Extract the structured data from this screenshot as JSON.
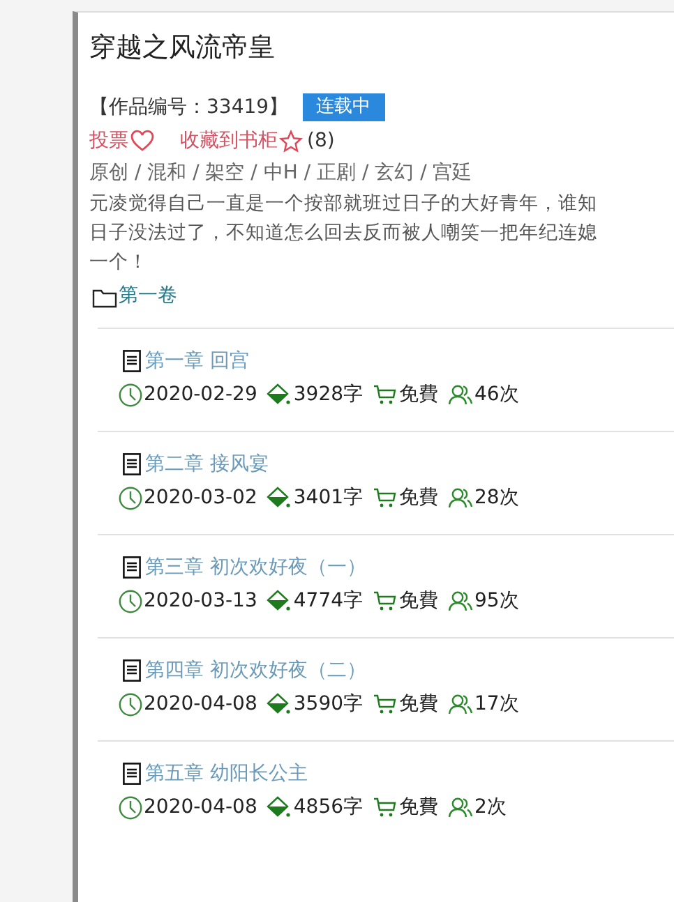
{
  "title": "穿越之风流帝皇",
  "work_id": "【作品编号：33419】",
  "status_badge": "连载中",
  "actions": [
    {
      "kind": "vote",
      "label": "投票"
    },
    {
      "kind": "favorite",
      "label": "收藏到书柜"
    }
  ],
  "favorite_count": "(8)",
  "tags": "原创 / 混和 / 架空 / 中H / 正剧 / 玄幻 / 宫廷",
  "summary_lines": [
    "元凌觉得自己一直是一个按部就班过日子的大好青年，谁知",
    "日子没法过了，不知道怎么回去反而被人嘲笑一把年纪连媳",
    "一个！"
  ],
  "volume": "第一卷",
  "chapters": [
    {
      "title": "第一章 回宫",
      "date": "2020-02-29",
      "words": "3928字",
      "price": "免費",
      "reads": "46次"
    },
    {
      "title": "第二章 接风宴",
      "date": "2020-03-02",
      "words": "3401字",
      "price": "免費",
      "reads": "28次"
    },
    {
      "title": "第三章 初次欢好夜（一）",
      "date": "2020-03-13",
      "words": "4774字",
      "price": "免費",
      "reads": "95次"
    },
    {
      "title": "第四章 初次欢好夜（二）",
      "date": "2020-04-08",
      "words": "3590字",
      "price": "免費",
      "reads": "17次"
    },
    {
      "title": "第五章 幼阳长公主",
      "date": "2020-04-08",
      "words": "4856字",
      "price": "免費",
      "reads": "2次"
    }
  ]
}
